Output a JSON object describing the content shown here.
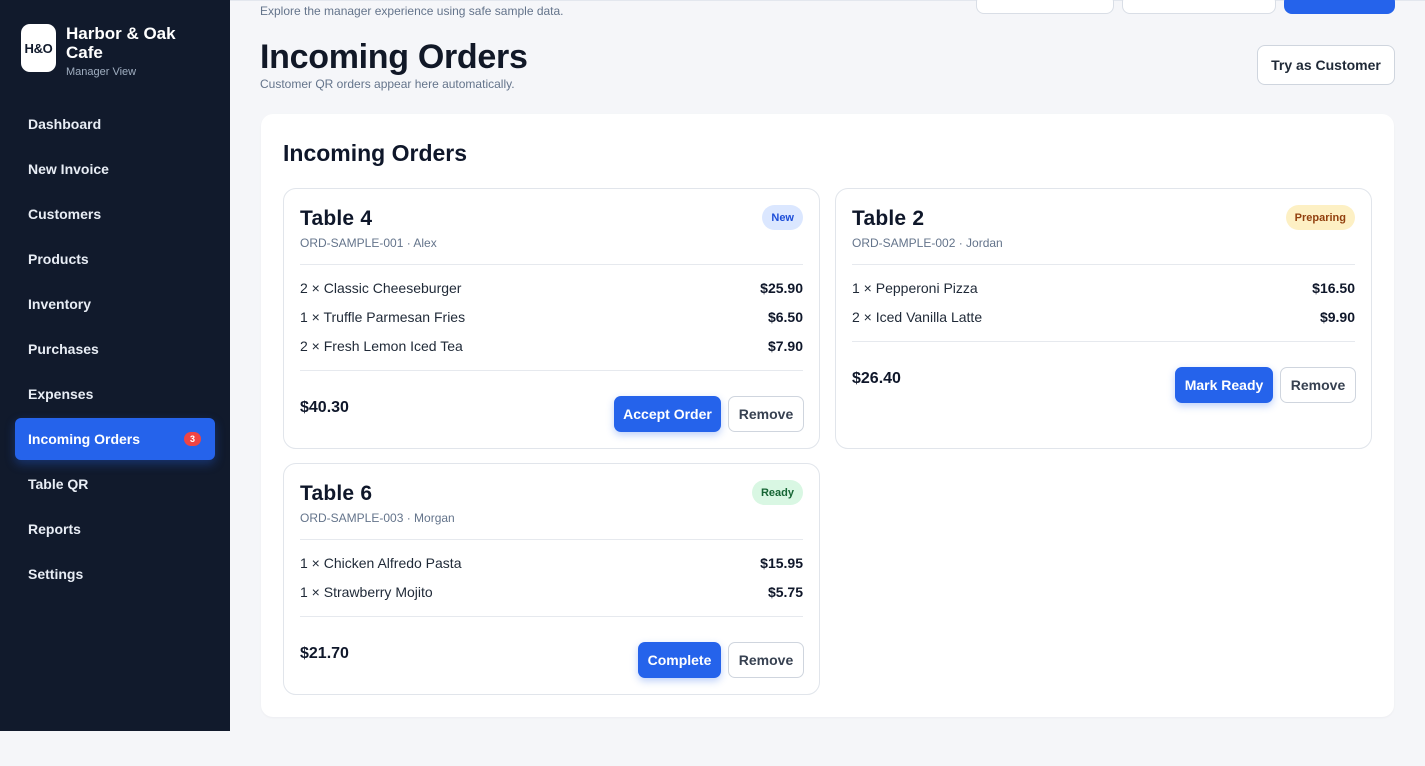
{
  "brand": {
    "logo": "H&O",
    "name": "Harbor & Oak Cafe",
    "subtitle": "Manager View"
  },
  "nav": {
    "items": [
      {
        "label": "Dashboard"
      },
      {
        "label": "New Invoice"
      },
      {
        "label": "Customers"
      },
      {
        "label": "Products"
      },
      {
        "label": "Inventory"
      },
      {
        "label": "Purchases"
      },
      {
        "label": "Expenses"
      },
      {
        "label": "Incoming Orders",
        "badge": "3",
        "active": true
      },
      {
        "label": "Table QR"
      },
      {
        "label": "Reports"
      },
      {
        "label": "Settings"
      }
    ]
  },
  "header": {
    "note": "Explore the manager experience using safe sample data.",
    "title": "Incoming Orders",
    "subtitle": "Customer QR orders appear here automatically.",
    "try_customer_label": "Try as Customer"
  },
  "panel": {
    "title": "Incoming Orders"
  },
  "orders": [
    {
      "table": "Table 4",
      "meta": "ORD-SAMPLE-001 · Alex",
      "status": "New",
      "items": [
        {
          "text": "2 × Classic Cheeseburger",
          "price": "$25.90"
        },
        {
          "text": "1 × Truffle Parmesan Fries",
          "price": "$6.50"
        },
        {
          "text": "2 × Fresh Lemon Iced Tea",
          "price": "$7.90"
        }
      ],
      "total": "$40.30",
      "primary_action": "Accept Order",
      "secondary_action": "Remove"
    },
    {
      "table": "Table 2",
      "meta": "ORD-SAMPLE-002 · Jordan",
      "status": "Preparing",
      "items": [
        {
          "text": "1 × Pepperoni Pizza",
          "price": "$16.50"
        },
        {
          "text": "2 × Iced Vanilla Latte",
          "price": "$9.90"
        }
      ],
      "total": "$26.40",
      "primary_action": "Mark Ready",
      "secondary_action": "Remove"
    },
    {
      "table": "Table 6",
      "meta": "ORD-SAMPLE-003 · Morgan",
      "status": "Ready",
      "items": [
        {
          "text": "1 × Chicken Alfredo Pasta",
          "price": "$15.95"
        },
        {
          "text": "1 × Strawberry Mojito",
          "price": "$5.75"
        }
      ],
      "total": "$21.70",
      "primary_action": "Complete",
      "secondary_action": "Remove"
    }
  ],
  "colors": {
    "sidebar": "#111a2c",
    "accent": "#2563eb",
    "badge": "#ef4444",
    "status_new": "#dbe7ff",
    "status_preparing": "#fdf0c4",
    "status_ready": "#d9f7e3"
  }
}
